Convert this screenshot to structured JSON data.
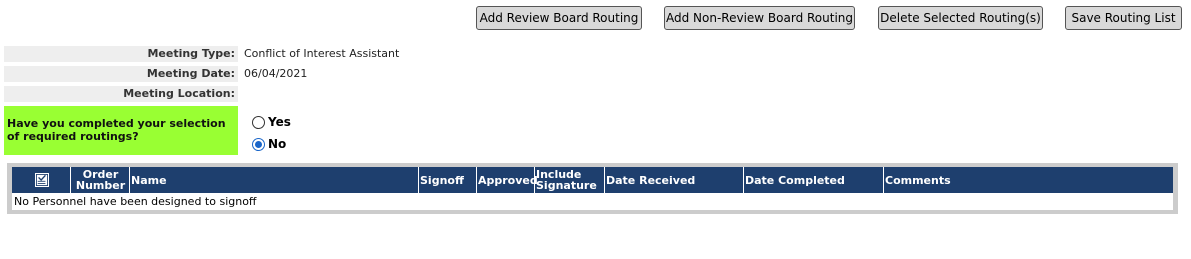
{
  "toolbar": {
    "add_review": "Add Review Board Routing",
    "add_non_review": "Add Non-Review Board Routing",
    "delete_selected": "Delete Selected Routing(s)",
    "save_list": "Save Routing List"
  },
  "meeting": {
    "type_label": "Meeting Type:",
    "type_value": "Conflict of Interest Assistant",
    "date_label": "Meeting Date:",
    "date_value": "06/04/2021",
    "location_label": "Meeting Location:",
    "location_value": ""
  },
  "question": {
    "text": "Have you completed your selection of required routings?",
    "options": [
      {
        "label": "Yes",
        "selected": false
      },
      {
        "label": "No",
        "selected": true
      }
    ]
  },
  "table": {
    "columns": [
      "Order Number",
      "Name",
      "Signoff",
      "Approved",
      "Include Signature",
      "Date Received",
      "Date Completed",
      "Comments"
    ],
    "empty_message": "No Personnel have been designed to signoff"
  },
  "colors": {
    "header_bg": "#1e3f6e",
    "question_bg": "#99ff33",
    "radio_accent": "#1a66c9"
  }
}
